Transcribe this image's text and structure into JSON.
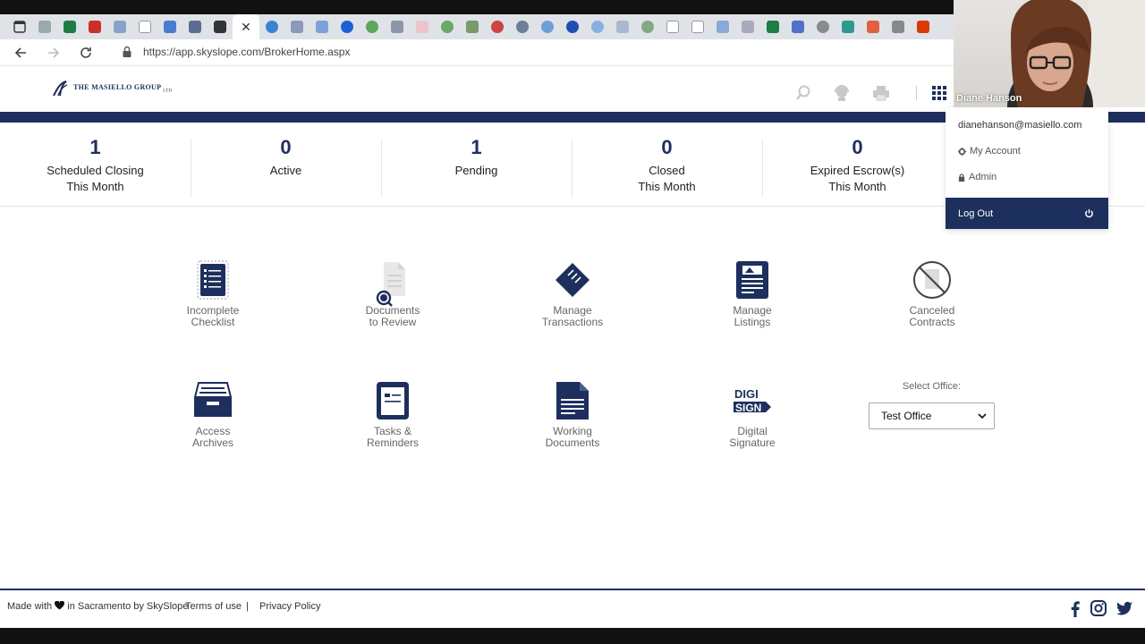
{
  "browser": {
    "url": "https://app.skyslope.com/BrokerHome.aspx",
    "close_glyph": "✕"
  },
  "logo": {
    "name": "THE MASIELLO GROUP",
    "suffix": "LTD"
  },
  "stats": [
    {
      "value": "1",
      "label": "Scheduled Closing\nThis Month"
    },
    {
      "value": "0",
      "label": "Active"
    },
    {
      "value": "1",
      "label": "Pending"
    },
    {
      "value": "0",
      "label": "Closed\nThis Month"
    },
    {
      "value": "0",
      "label": "Expired Escrow(s)\nThis Month"
    }
  ],
  "tiles": [
    {
      "label": "Incomplete\nChecklist",
      "icon": "checklist-icon"
    },
    {
      "label": "Documents\nto Review",
      "icon": "document-search-icon"
    },
    {
      "label": "Manage\nTransactions",
      "icon": "ticket-icon"
    },
    {
      "label": "Manage\nListings",
      "icon": "listing-icon"
    },
    {
      "label": "Canceled\nContracts",
      "icon": "canceled-icon"
    },
    {
      "label": "Access\nArchives",
      "icon": "archive-box-icon"
    },
    {
      "label": "Tasks &\nReminders",
      "icon": "clipboard-icon"
    },
    {
      "label": "Working\nDocuments",
      "icon": "document-icon"
    },
    {
      "label": "Digital\nSignature",
      "icon": "digisign-icon"
    }
  ],
  "digisign": {
    "line1": "DIGI",
    "line2": "SIGN"
  },
  "office": {
    "label": "Select Office:",
    "selected": "Test Office"
  },
  "user_menu": {
    "email": "dianehanson@masiello.com",
    "my_account": "My Account",
    "admin": "Admin",
    "logout": "Log Out"
  },
  "video": {
    "participant_name": "Diane Hanson"
  },
  "footer": {
    "made_with_prefix": "Made with",
    "made_with_suffix": "in Sacramento by SkySlope",
    "terms": "Terms of use",
    "separator": "|",
    "privacy": "Privacy Policy"
  },
  "colors": {
    "brand_navy": "#1d2f5c",
    "tile_gray": "#666666"
  }
}
